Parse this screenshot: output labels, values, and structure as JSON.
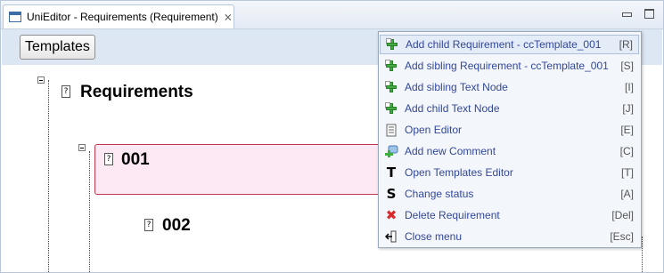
{
  "window": {
    "tab_title": "UniEditor - Requirements (Requirement)",
    "close_glyph": "⨯"
  },
  "toolbar": {
    "templates_label": "Templates"
  },
  "tree": {
    "root_label": "Requirements",
    "node1_label": "001",
    "node2_label": "002",
    "doc_glyph": "?"
  },
  "context_menu": {
    "items": [
      {
        "label": "Add child Requirement - ccTemplate_001",
        "shortcut": "[R]",
        "icon": "add-plus-icon"
      },
      {
        "label": "Add sibling Requirement - ccTemplate_001",
        "shortcut": "[S]",
        "icon": "add-plus-icon"
      },
      {
        "label": "Add sibling Text Node",
        "shortcut": "[I]",
        "icon": "add-plus-icon"
      },
      {
        "label": "Add child Text Node",
        "shortcut": "[J]",
        "icon": "add-plus-icon"
      },
      {
        "label": "Open Editor",
        "shortcut": "[E]",
        "icon": "editor-document-icon"
      },
      {
        "label": "Add new Comment",
        "shortcut": "[C]",
        "icon": "add-comment-icon"
      },
      {
        "label": "Open Templates Editor",
        "shortcut": "[T]",
        "icon": "templates-t-icon"
      },
      {
        "label": "Change status",
        "shortcut": "[A]",
        "icon": "status-s-icon"
      },
      {
        "label": "Delete Requirement",
        "shortcut": "[Del]",
        "icon": "delete-x-icon"
      },
      {
        "label": "Close menu",
        "shortcut": "[Esc]",
        "icon": "close-menu-icon"
      }
    ],
    "glyphs": {
      "t": "T",
      "s": "S",
      "x": "✖",
      "exit": "⇤"
    }
  },
  "colors": {
    "menu_text": "#33489a",
    "selection_fill": "#fde9f3",
    "selection_border": "#c0394b",
    "plus_green": "#3fae3f"
  }
}
